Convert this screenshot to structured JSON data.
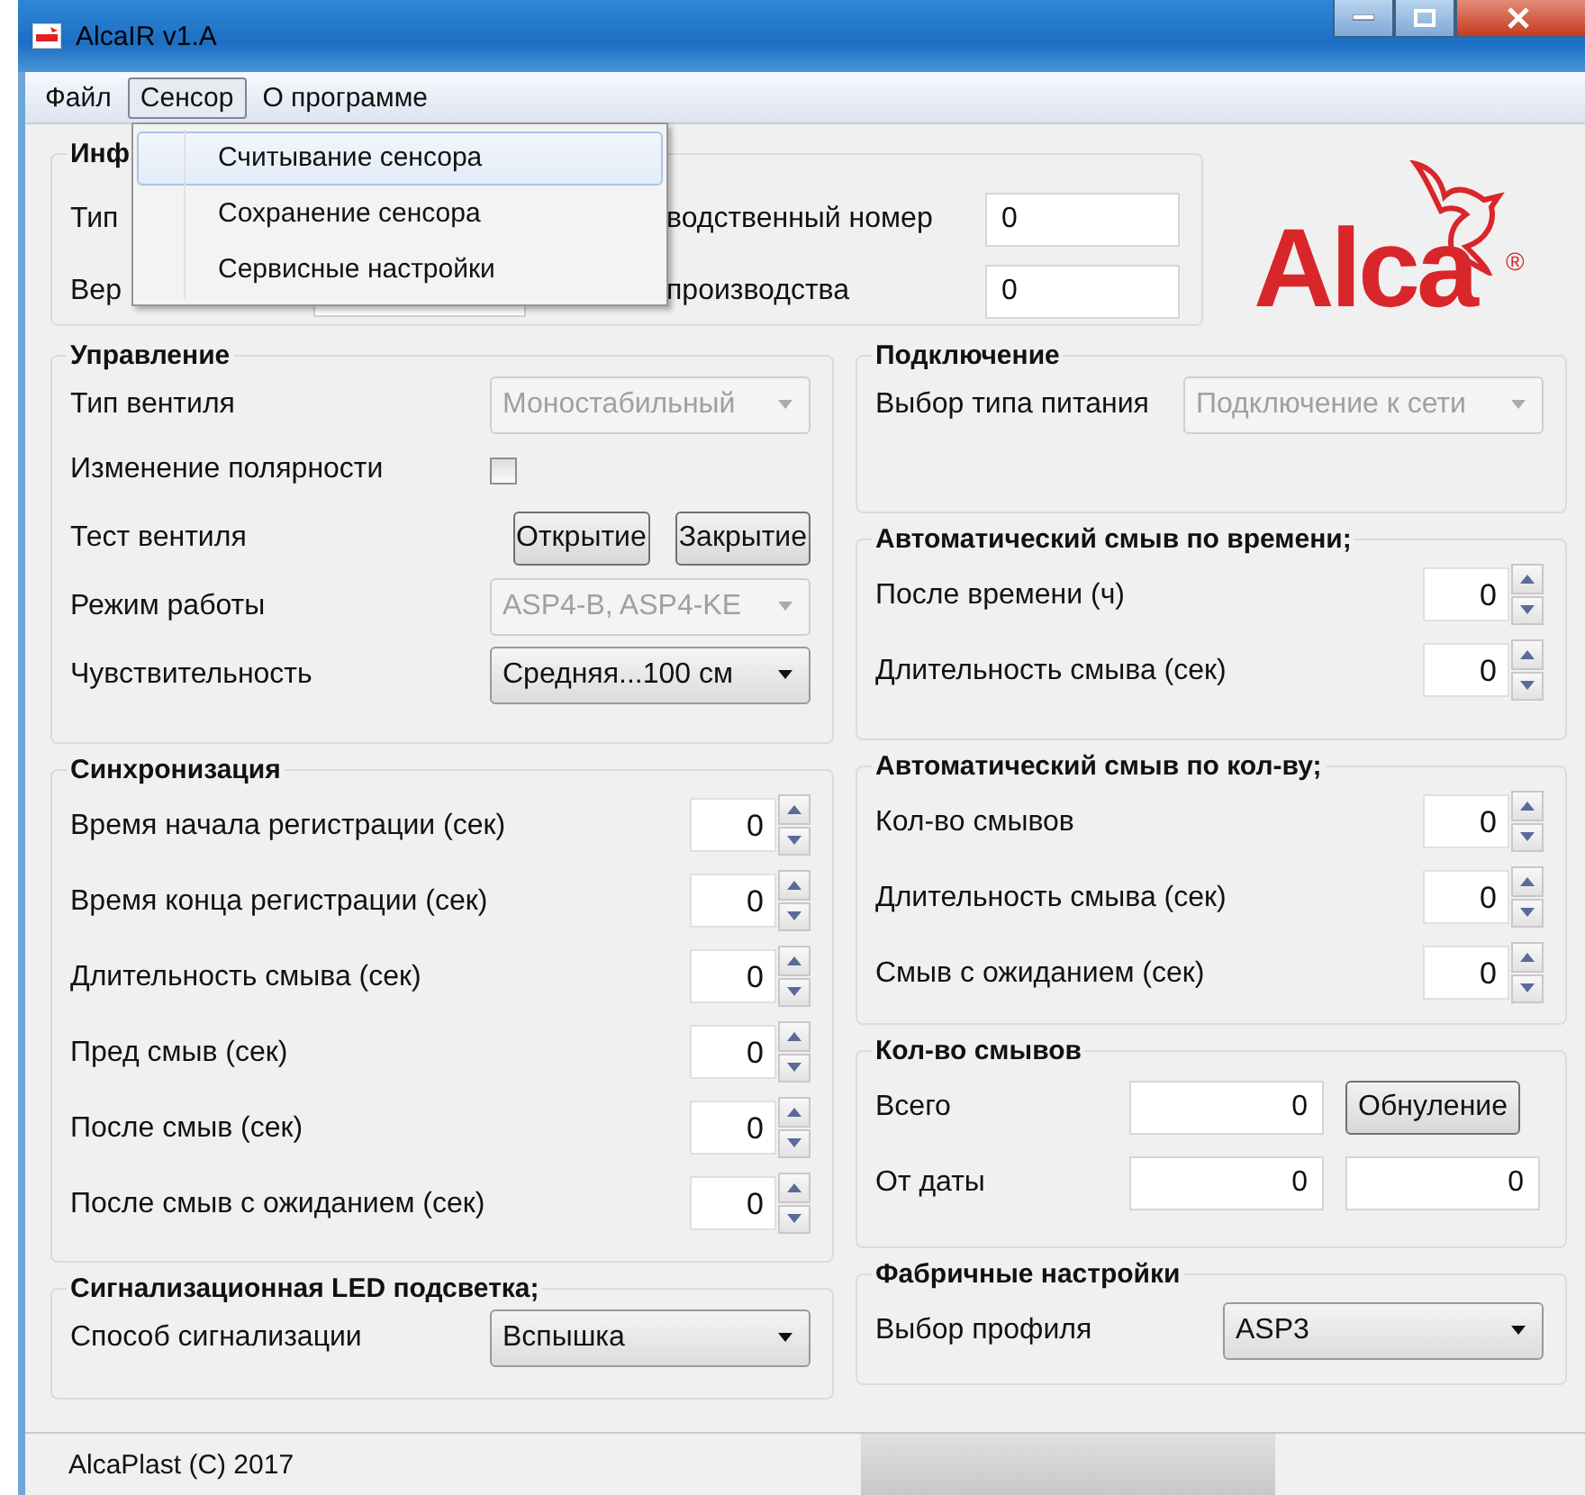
{
  "window": {
    "title": "AlcaIR  v1.A"
  },
  "menu": [
    {
      "label": "Файл",
      "selected": false
    },
    {
      "label": "Сенсор",
      "selected": true
    },
    {
      "label": "О программе",
      "selected": false
    }
  ],
  "dropdown": [
    {
      "label": "Считывание сенсора",
      "selected": true
    },
    {
      "label": "Сохранение сенсора",
      "selected": false
    },
    {
      "label": "Сервисные настройки",
      "selected": false
    }
  ],
  "info": {
    "title": "Инф",
    "rows": [
      {
        "label": "Тип",
        "field_label": "водственный номер",
        "value": "0"
      },
      {
        "label": "Вер",
        "field_label": "производства",
        "value": "0"
      }
    ]
  },
  "logo": {
    "text": "Alca",
    "mark": "®"
  },
  "left_groups": [
    {
      "title": "Управление",
      "rows": [
        {
          "kind": "select",
          "label": "Тип вентиля",
          "value": "Моностабильный",
          "disabled": true
        },
        {
          "kind": "checkbox",
          "label": "Изменение полярности",
          "checked": false
        },
        {
          "kind": "buttons",
          "label": "Тест вентиля",
          "buttons": [
            "Открытие",
            "Закрытие"
          ]
        },
        {
          "kind": "select",
          "label": "Режим работы",
          "value": "ASP4-B, ASP4-KE",
          "disabled": true
        },
        {
          "kind": "select",
          "label": "Чувствительность",
          "value": "Средняя...100 см",
          "disabled": false
        }
      ]
    },
    {
      "title": "Синхронизация",
      "rows": [
        {
          "kind": "spin",
          "label": "Время начала регистрации (сек)",
          "value": "0"
        },
        {
          "kind": "spin",
          "label": "Время конца регистрации (сек)",
          "value": "0"
        },
        {
          "kind": "spin",
          "label": "Длительность смыва (сек)",
          "value": "0"
        },
        {
          "kind": "spin",
          "label": "Пред смыв (сек)",
          "value": "0"
        },
        {
          "kind": "spin",
          "label": "После смыв (сек)",
          "value": "0"
        },
        {
          "kind": "spin",
          "label": "После смыв  с ожиданием (сек)",
          "value": "0"
        }
      ]
    },
    {
      "title": "Сигнализационная LED подсветка;",
      "rows": [
        {
          "kind": "select",
          "label": "Способ сигнализации",
          "value": "Вспышка",
          "disabled": false
        }
      ]
    }
  ],
  "right_groups": [
    {
      "title": "Подключение",
      "rows": [
        {
          "kind": "select",
          "label": "Выбор типа питания",
          "value": "Подключение к сети",
          "disabled": true
        }
      ]
    },
    {
      "title": "Автоматический смыв по времени;",
      "rows": [
        {
          "kind": "spin",
          "label": "После времени (ч)",
          "value": "0"
        },
        {
          "kind": "spin",
          "label": "Длительность смыва (сек)",
          "value": "0"
        }
      ]
    },
    {
      "title": "Автоматический смыв по кол-ву;",
      "rows": [
        {
          "kind": "spin",
          "label": "Кол-во смывов",
          "value": "0"
        },
        {
          "kind": "spin",
          "label": "Длительность смыва (сек)",
          "value": "0"
        },
        {
          "kind": "spin",
          "label": "Смыв с ожиданием (сек)",
          "value": "0"
        }
      ]
    },
    {
      "title": "Кол-во смывов",
      "rows": [
        {
          "kind": "fields",
          "label": "Всего",
          "values": [
            "0"
          ],
          "button": "Обнуление"
        },
        {
          "kind": "fields",
          "label": "От даты",
          "values": [
            "0",
            "0"
          ]
        }
      ]
    },
    {
      "title": "Фабричные настройки",
      "rows": [
        {
          "kind": "select",
          "label": "Выбор профиля",
          "value": "ASP3",
          "disabled": false
        }
      ]
    }
  ],
  "status_bar": {
    "text": "AlcaPlast  (C) 2017"
  }
}
